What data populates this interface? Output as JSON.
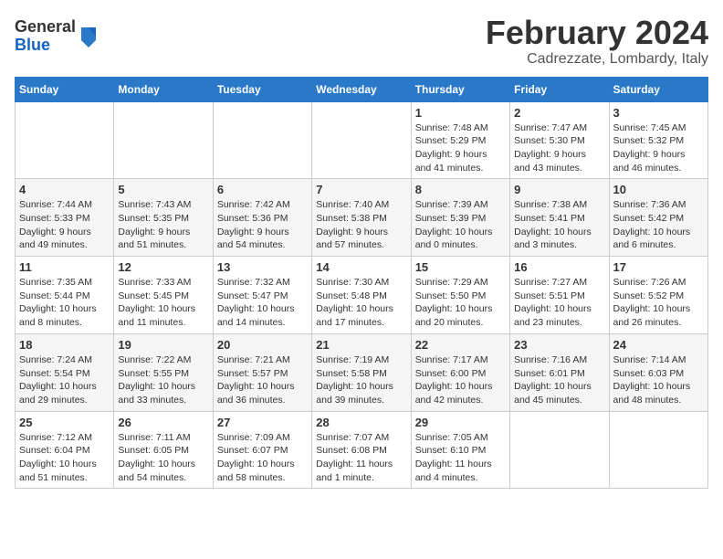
{
  "header": {
    "logo_general": "General",
    "logo_blue": "Blue",
    "title": "February 2024",
    "location": "Cadrezzate, Lombardy, Italy"
  },
  "days_of_week": [
    "Sunday",
    "Monday",
    "Tuesday",
    "Wednesday",
    "Thursday",
    "Friday",
    "Saturday"
  ],
  "weeks": [
    [
      {
        "day": "",
        "info": ""
      },
      {
        "day": "",
        "info": ""
      },
      {
        "day": "",
        "info": ""
      },
      {
        "day": "",
        "info": ""
      },
      {
        "day": "1",
        "info": "Sunrise: 7:48 AM\nSunset: 5:29 PM\nDaylight: 9 hours\nand 41 minutes."
      },
      {
        "day": "2",
        "info": "Sunrise: 7:47 AM\nSunset: 5:30 PM\nDaylight: 9 hours\nand 43 minutes."
      },
      {
        "day": "3",
        "info": "Sunrise: 7:45 AM\nSunset: 5:32 PM\nDaylight: 9 hours\nand 46 minutes."
      }
    ],
    [
      {
        "day": "4",
        "info": "Sunrise: 7:44 AM\nSunset: 5:33 PM\nDaylight: 9 hours\nand 49 minutes."
      },
      {
        "day": "5",
        "info": "Sunrise: 7:43 AM\nSunset: 5:35 PM\nDaylight: 9 hours\nand 51 minutes."
      },
      {
        "day": "6",
        "info": "Sunrise: 7:42 AM\nSunset: 5:36 PM\nDaylight: 9 hours\nand 54 minutes."
      },
      {
        "day": "7",
        "info": "Sunrise: 7:40 AM\nSunset: 5:38 PM\nDaylight: 9 hours\nand 57 minutes."
      },
      {
        "day": "8",
        "info": "Sunrise: 7:39 AM\nSunset: 5:39 PM\nDaylight: 10 hours\nand 0 minutes."
      },
      {
        "day": "9",
        "info": "Sunrise: 7:38 AM\nSunset: 5:41 PM\nDaylight: 10 hours\nand 3 minutes."
      },
      {
        "day": "10",
        "info": "Sunrise: 7:36 AM\nSunset: 5:42 PM\nDaylight: 10 hours\nand 6 minutes."
      }
    ],
    [
      {
        "day": "11",
        "info": "Sunrise: 7:35 AM\nSunset: 5:44 PM\nDaylight: 10 hours\nand 8 minutes."
      },
      {
        "day": "12",
        "info": "Sunrise: 7:33 AM\nSunset: 5:45 PM\nDaylight: 10 hours\nand 11 minutes."
      },
      {
        "day": "13",
        "info": "Sunrise: 7:32 AM\nSunset: 5:47 PM\nDaylight: 10 hours\nand 14 minutes."
      },
      {
        "day": "14",
        "info": "Sunrise: 7:30 AM\nSunset: 5:48 PM\nDaylight: 10 hours\nand 17 minutes."
      },
      {
        "day": "15",
        "info": "Sunrise: 7:29 AM\nSunset: 5:50 PM\nDaylight: 10 hours\nand 20 minutes."
      },
      {
        "day": "16",
        "info": "Sunrise: 7:27 AM\nSunset: 5:51 PM\nDaylight: 10 hours\nand 23 minutes."
      },
      {
        "day": "17",
        "info": "Sunrise: 7:26 AM\nSunset: 5:52 PM\nDaylight: 10 hours\nand 26 minutes."
      }
    ],
    [
      {
        "day": "18",
        "info": "Sunrise: 7:24 AM\nSunset: 5:54 PM\nDaylight: 10 hours\nand 29 minutes."
      },
      {
        "day": "19",
        "info": "Sunrise: 7:22 AM\nSunset: 5:55 PM\nDaylight: 10 hours\nand 33 minutes."
      },
      {
        "day": "20",
        "info": "Sunrise: 7:21 AM\nSunset: 5:57 PM\nDaylight: 10 hours\nand 36 minutes."
      },
      {
        "day": "21",
        "info": "Sunrise: 7:19 AM\nSunset: 5:58 PM\nDaylight: 10 hours\nand 39 minutes."
      },
      {
        "day": "22",
        "info": "Sunrise: 7:17 AM\nSunset: 6:00 PM\nDaylight: 10 hours\nand 42 minutes."
      },
      {
        "day": "23",
        "info": "Sunrise: 7:16 AM\nSunset: 6:01 PM\nDaylight: 10 hours\nand 45 minutes."
      },
      {
        "day": "24",
        "info": "Sunrise: 7:14 AM\nSunset: 6:03 PM\nDaylight: 10 hours\nand 48 minutes."
      }
    ],
    [
      {
        "day": "25",
        "info": "Sunrise: 7:12 AM\nSunset: 6:04 PM\nDaylight: 10 hours\nand 51 minutes."
      },
      {
        "day": "26",
        "info": "Sunrise: 7:11 AM\nSunset: 6:05 PM\nDaylight: 10 hours\nand 54 minutes."
      },
      {
        "day": "27",
        "info": "Sunrise: 7:09 AM\nSunset: 6:07 PM\nDaylight: 10 hours\nand 58 minutes."
      },
      {
        "day": "28",
        "info": "Sunrise: 7:07 AM\nSunset: 6:08 PM\nDaylight: 11 hours\nand 1 minute."
      },
      {
        "day": "29",
        "info": "Sunrise: 7:05 AM\nSunset: 6:10 PM\nDaylight: 11 hours\nand 4 minutes."
      },
      {
        "day": "",
        "info": ""
      },
      {
        "day": "",
        "info": ""
      }
    ]
  ]
}
